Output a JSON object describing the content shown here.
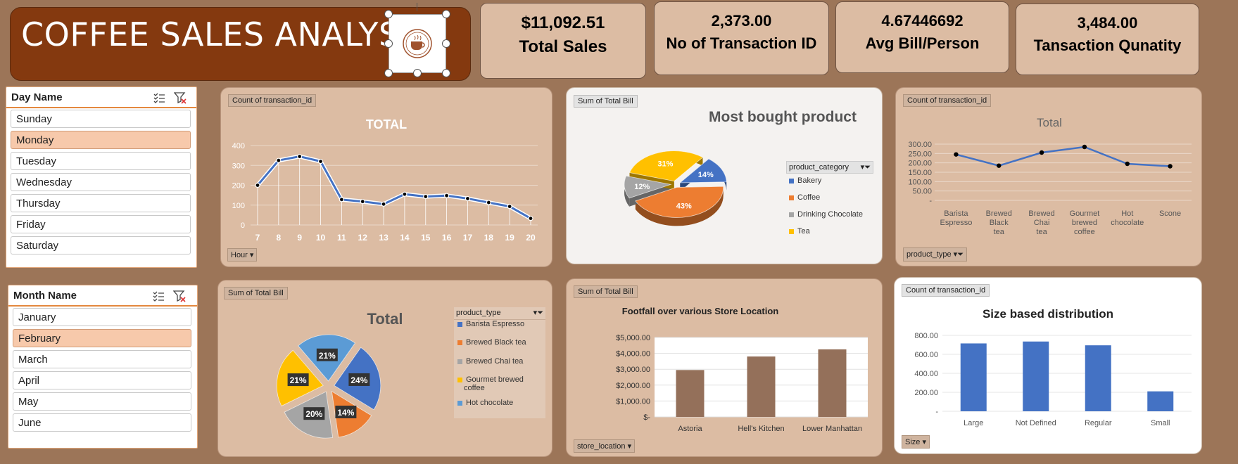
{
  "header": {
    "title": "COFFEE SALES ANALYSIS"
  },
  "kpis": [
    {
      "value": "$11,092.51",
      "label": "Total Sales"
    },
    {
      "value": "2,373.00",
      "label": "No of Transaction ID"
    },
    {
      "value": "4.67446692",
      "label": "Avg Bill/Person"
    },
    {
      "value": "3,484.00",
      "label": "Tansaction Qunatity"
    }
  ],
  "slicers": {
    "day": {
      "title": "Day Name",
      "items": [
        "Sunday",
        "Monday",
        "Tuesday",
        "Wednesday",
        "Thursday",
        "Friday",
        "Saturday"
      ],
      "selected": "Monday"
    },
    "month": {
      "title": "Month Name",
      "items": [
        "January",
        "February",
        "March",
        "April",
        "May",
        "June"
      ],
      "selected": "February"
    }
  },
  "hourly": {
    "field_tag": "Count of transaction_id",
    "axis_button": "Hour",
    "chart_data": {
      "type": "line",
      "title": "TOTAL",
      "x": [
        7,
        8,
        9,
        10,
        11,
        12,
        13,
        14,
        15,
        16,
        17,
        18,
        19,
        20
      ],
      "values": [
        200,
        325,
        345,
        320,
        128,
        118,
        105,
        155,
        143,
        148,
        133,
        113,
        93,
        33
      ],
      "ylim": [
        0,
        400
      ],
      "yticks": [
        0,
        100,
        200,
        300,
        400
      ]
    }
  },
  "most_bought": {
    "field_tag": "Sum of Total Bill",
    "legend_title": "product_category",
    "chart_data": {
      "type": "pie",
      "title": "Most bought product",
      "categories": [
        "Bakery",
        "Coffee",
        "Drinking Chocolate",
        "Tea"
      ],
      "values": [
        14,
        43,
        12,
        31
      ],
      "labels": [
        "14%",
        "43%",
        "12%",
        "31%"
      ],
      "colors": [
        "#4472c4",
        "#ed7d31",
        "#a5a5a5",
        "#ffc000"
      ]
    }
  },
  "product_type_line": {
    "field_tag": "Count of transaction_id",
    "axis_button": "product_type",
    "chart_data": {
      "type": "line",
      "title": "Total",
      "categories": [
        "Barista Espresso",
        "Brewed Black tea",
        "Brewed Chai tea",
        "Gourmet brewed coffee",
        "Hot chocolate",
        "Scone"
      ],
      "values": [
        245,
        185,
        255,
        285,
        195,
        182
      ],
      "ylim": [
        0,
        300
      ],
      "ytick_labels": [
        "-",
        "50.00",
        "100.00",
        "150.00",
        "200.00",
        "250.00",
        "300.00"
      ]
    }
  },
  "product_type_pie": {
    "field_tag": "Sum of Total Bill",
    "legend_title": "product_type",
    "chart_data": {
      "type": "pie",
      "title": "Total",
      "categories": [
        "Barista Espresso",
        "Brewed Black tea",
        "Brewed Chai tea",
        "Gourmet brewed coffee",
        "Hot chocolate"
      ],
      "values": [
        24,
        14,
        20,
        21,
        21
      ],
      "labels": [
        "24%",
        "14%",
        "20%",
        "21%",
        "21%"
      ],
      "colors": [
        "#4472c4",
        "#ed7d31",
        "#a5a5a5",
        "#ffc000",
        "#5b9bd5"
      ]
    }
  },
  "footfall": {
    "field_tag": "Sum of Total Bill",
    "axis_button": "store_location",
    "chart_data": {
      "type": "bar",
      "title": "Footfall over various Store Location",
      "categories": [
        "Astoria",
        "Hell's Kitchen",
        "Lower Manhattan"
      ],
      "values": [
        2950,
        3800,
        4250
      ],
      "ylim": [
        0,
        5000
      ],
      "ytick_labels": [
        "$-",
        "$1,000.00",
        "$2,000.00",
        "$3,000.00",
        "$4,000.00",
        "$5,000.00"
      ],
      "color": "#94705a"
    }
  },
  "size_dist": {
    "field_tag": "Count of transaction_id",
    "axis_button": "Size",
    "chart_data": {
      "type": "bar",
      "title": "Size based distribution",
      "categories": [
        "Large",
        "Not  Defined",
        "Regular",
        "Small"
      ],
      "values": [
        715,
        735,
        695,
        210
      ],
      "ylim": [
        0,
        800
      ],
      "ytick_labels": [
        "-",
        "200.00",
        "400.00",
        "600.00",
        "800.00"
      ],
      "color": "#4472c4"
    }
  }
}
